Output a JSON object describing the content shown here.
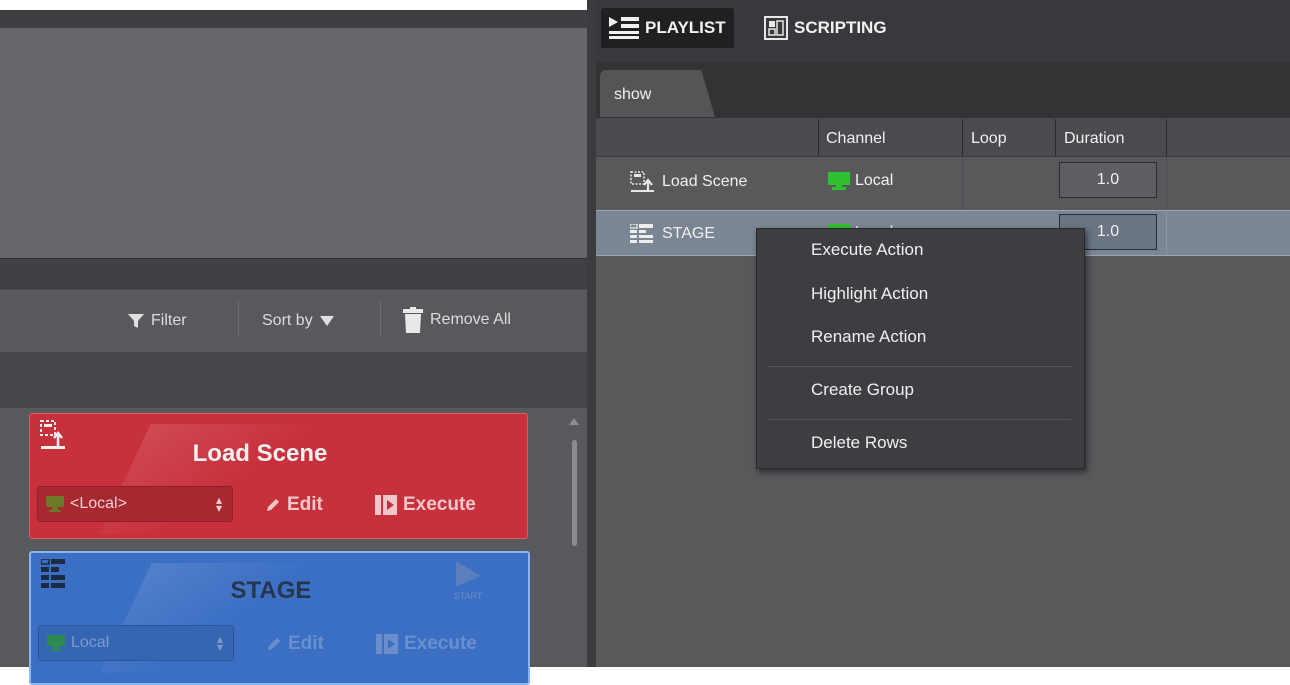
{
  "app": {
    "tabs": [
      {
        "label": "PLAYLIST",
        "icon": "playlist-icon"
      },
      {
        "label": "SCRIPTING",
        "icon": "scripting-icon"
      }
    ]
  },
  "left_toolbar": {
    "filter_label": "Filter",
    "sort_label": "Sort by",
    "remove_all_label": "Remove All"
  },
  "action_cards": [
    {
      "title": "Load Scene",
      "channel": "<Local>",
      "edit_label": "Edit",
      "execute_label": "Execute",
      "color": "#c8313c"
    },
    {
      "title": "STAGE",
      "channel": "Local",
      "edit_label": "Edit",
      "execute_label": "Execute",
      "start_label": "START",
      "color": "#3a6fc4"
    }
  ],
  "playlist": {
    "document_tab": "show",
    "columns": [
      "",
      "Channel",
      "Loop",
      "Duration"
    ],
    "rows": [
      {
        "name": "Load Scene",
        "channel": "Local",
        "loop": "",
        "duration": "1.0",
        "selected": false
      },
      {
        "name": "STAGE",
        "channel": "Local",
        "loop": "",
        "duration": "1.0",
        "selected": true
      }
    ]
  },
  "context_menu": {
    "items": [
      "Execute Action",
      "Highlight Action",
      "Rename Action",
      "Create Group",
      "Delete Rows"
    ]
  },
  "colors": {
    "monitor_green": "#2fc12f",
    "selection": "#7b8695"
  }
}
